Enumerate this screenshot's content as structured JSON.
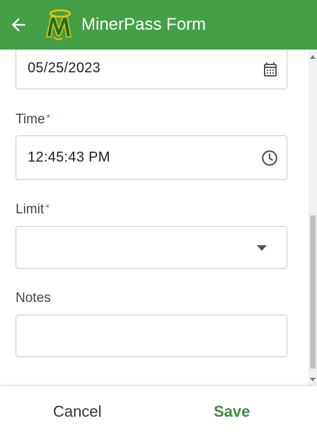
{
  "header": {
    "title": "MinerPass Form",
    "back_icon": "arrow-left-icon",
    "logo_icon": "miners-logo-icon",
    "color": "#43a047"
  },
  "form": {
    "date": {
      "value": "05/25/2023",
      "icon": "calendar-icon"
    },
    "time": {
      "label": "Time",
      "required_mark": "*",
      "value": "12:45:43 PM",
      "icon": "clock-icon"
    },
    "limit": {
      "label": "Limit",
      "required_mark": "*",
      "value": "",
      "icon": "caret-down-icon"
    },
    "notes": {
      "label": "Notes",
      "value": ""
    }
  },
  "footer": {
    "cancel_label": "Cancel",
    "save_label": "Save",
    "save_color": "#3e8e41"
  }
}
